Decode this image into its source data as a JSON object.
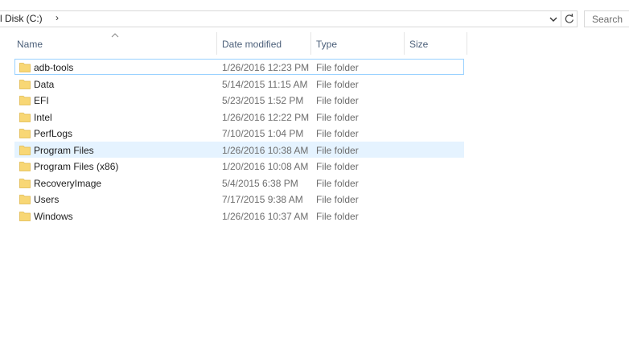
{
  "address": {
    "crumb": "l Disk (C:)",
    "separator": "›"
  },
  "search": {
    "placeholder": "Search"
  },
  "columns": {
    "name": "Name",
    "date_modified": "Date modified",
    "type": "Type",
    "size": "Size"
  },
  "icons": {
    "folder": "folder-icon",
    "sort": "sort-up-icon",
    "dropdown": "chevron-down-icon",
    "refresh": "refresh-icon"
  },
  "colors": {
    "folder": "#f8d775",
    "hover_bg": "#e5f3ff",
    "focus_border": "#99d1ff",
    "header_text": "#4c607a"
  },
  "rows": [
    {
      "name": "adb-tools",
      "date": "1/26/2016 12:23 PM",
      "type": "File folder"
    },
    {
      "name": "Data",
      "date": "5/14/2015 11:15 AM",
      "type": "File folder"
    },
    {
      "name": "EFI",
      "date": "5/23/2015 1:52 PM",
      "type": "File folder"
    },
    {
      "name": "Intel",
      "date": "1/26/2016 12:22 PM",
      "type": "File folder"
    },
    {
      "name": "PerfLogs",
      "date": "7/10/2015 1:04 PM",
      "type": "File folder"
    },
    {
      "name": "Program Files",
      "date": "1/26/2016 10:38 AM",
      "type": "File folder"
    },
    {
      "name": "Program Files (x86)",
      "date": "1/20/2016 10:08 AM",
      "type": "File folder"
    },
    {
      "name": "RecoveryImage",
      "date": "5/4/2015 6:38 PM",
      "type": "File folder"
    },
    {
      "name": "Users",
      "date": "7/17/2015 9:38 AM",
      "type": "File folder"
    },
    {
      "name": "Windows",
      "date": "1/26/2016 10:37 AM",
      "type": "File folder"
    }
  ]
}
